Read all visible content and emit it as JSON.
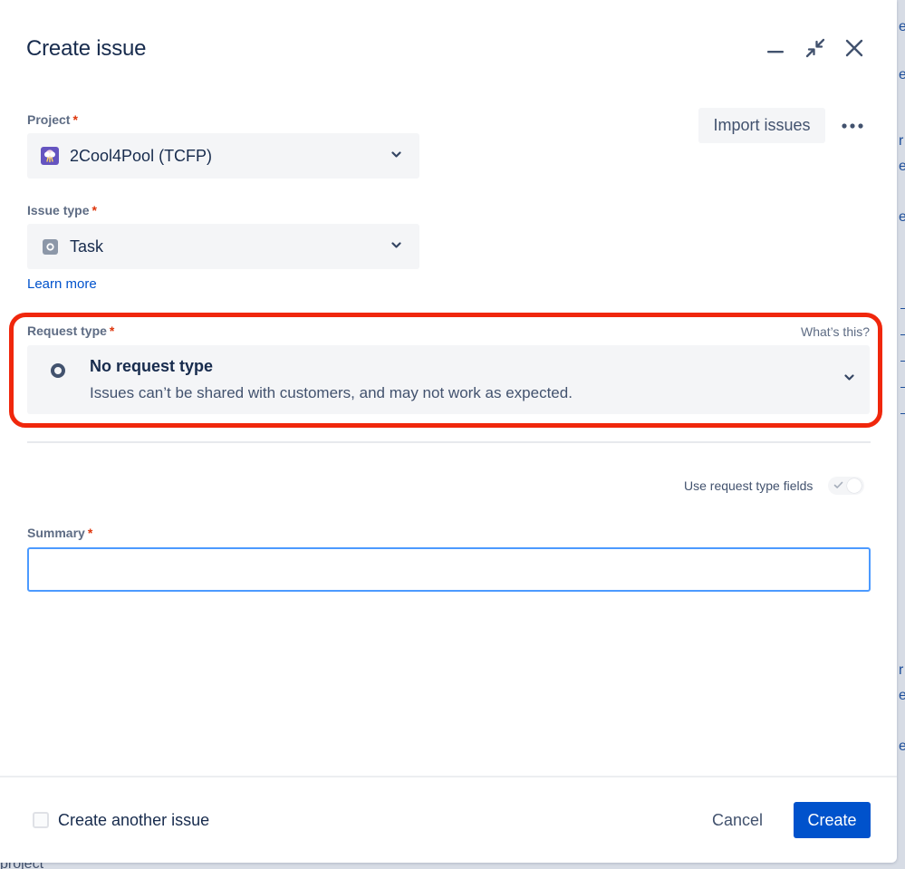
{
  "dialog": {
    "title": "Create issue",
    "header_icons": [
      "minimize-icon",
      "collapse-icon",
      "close-icon"
    ]
  },
  "project": {
    "label": "Project",
    "required_mark": "*",
    "value": "2Cool4Pool (TCFP)",
    "icon": "project-avatar-icon"
  },
  "actions": {
    "import_label": "Import issues",
    "more_icon": "more-icon"
  },
  "issue_type": {
    "label": "Issue type",
    "required_mark": "*",
    "value": "Task",
    "icon": "task-icon",
    "learn_more": "Learn more"
  },
  "request_type": {
    "label": "Request type",
    "required_mark": "*",
    "help_link": "What’s this?",
    "value_title": "No request type",
    "value_description": "Issues can’t be shared with customers, and may not work as expected.",
    "highlight_color": "#f0270c"
  },
  "request_fields_toggle": {
    "label": "Use request type fields",
    "on": false
  },
  "summary": {
    "label": "Summary",
    "required_mark": "*",
    "value": ""
  },
  "footer": {
    "create_another_label": "Create another issue",
    "create_another_checked": false,
    "cancel_label": "Cancel",
    "create_label": "Create"
  },
  "colors": {
    "primary": "#0052cc",
    "required": "#de350b",
    "focus_border": "#4c9aff"
  },
  "background_page": {
    "bottom_text": "project"
  }
}
